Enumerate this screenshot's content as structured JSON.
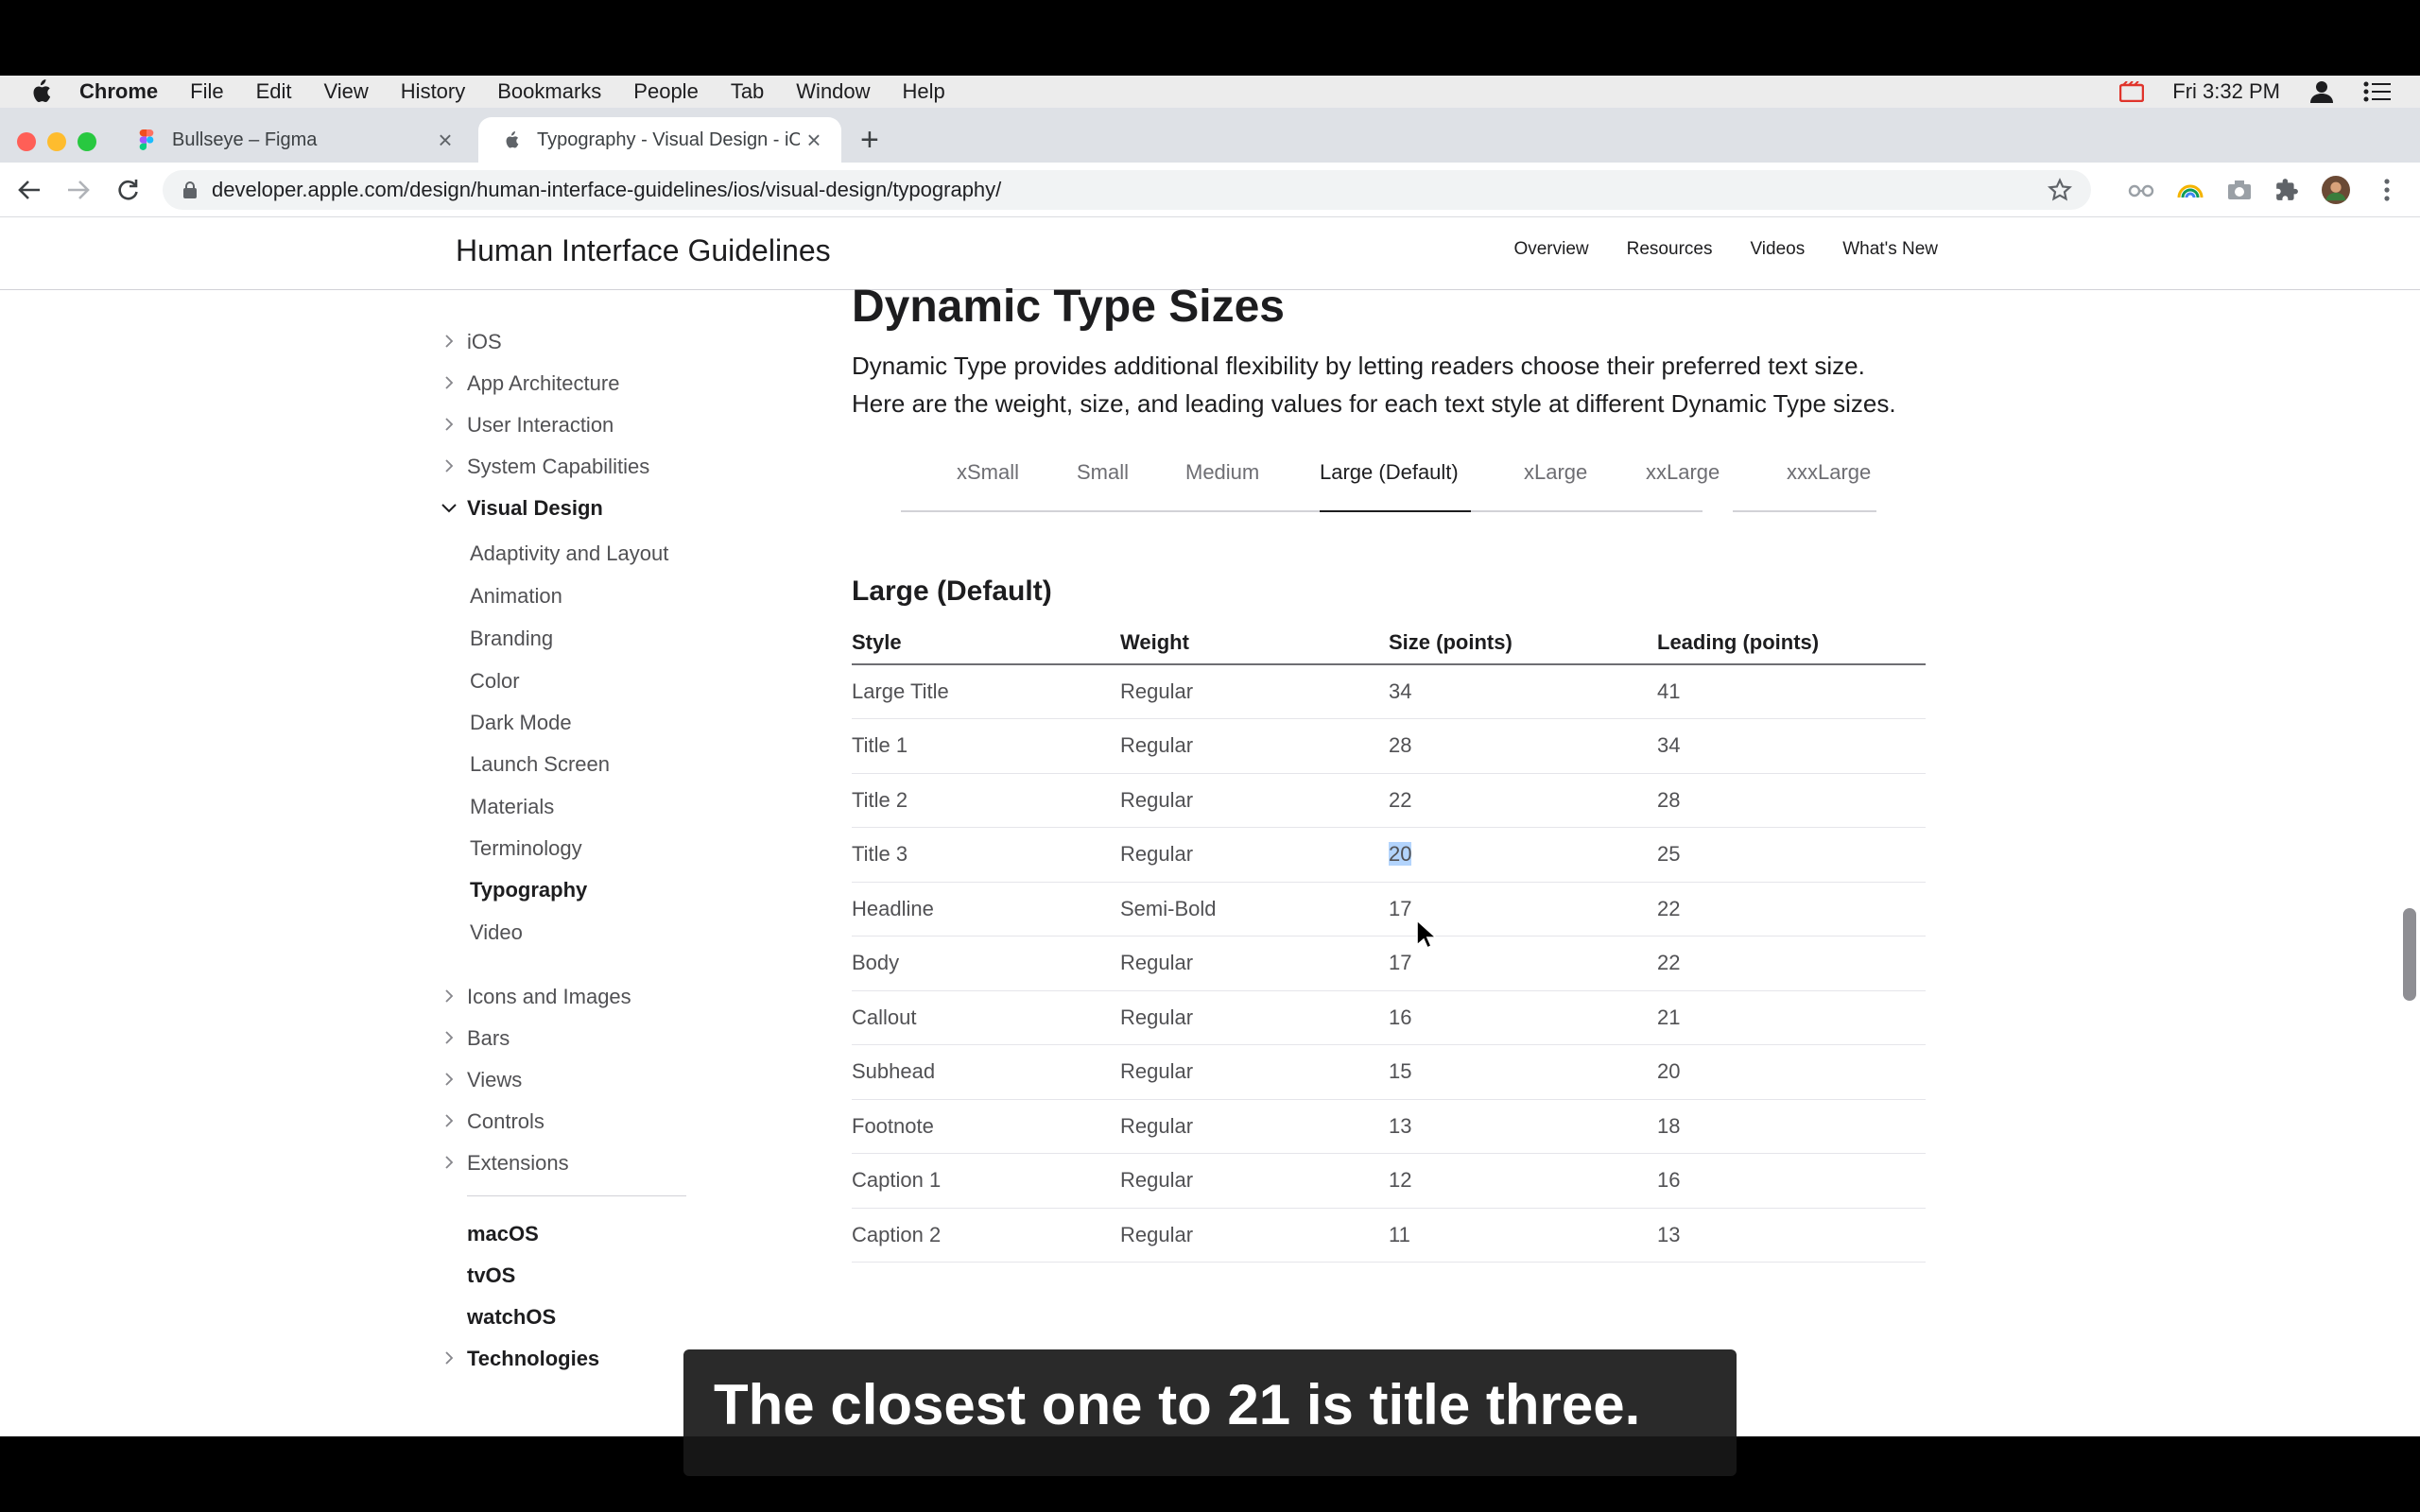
{
  "menubar": {
    "app": "Chrome",
    "items": [
      "File",
      "Edit",
      "View",
      "History",
      "Bookmarks",
      "People",
      "Tab",
      "Window",
      "Help"
    ],
    "clock": "Fri 3:32 PM"
  },
  "tabs": [
    {
      "title": "Bullseye – Figma",
      "icon": "figma-icon"
    },
    {
      "title": "Typography - Visual Design - iO",
      "icon": "apple-icon"
    }
  ],
  "address": "developer.apple.com/design/human-interface-guidelines/ios/visual-design/typography/",
  "header": {
    "title": "Human Interface Guidelines",
    "nav": [
      "Overview",
      "Resources",
      "Videos",
      "What's New"
    ]
  },
  "sidebar": {
    "collapsed_top": [
      "iOS",
      "App Architecture",
      "User Interaction",
      "System Capabilities"
    ],
    "expanded": "Visual Design",
    "sub": [
      "Adaptivity and Layout",
      "Animation",
      "Branding",
      "Color",
      "Dark Mode",
      "Launch Screen",
      "Materials",
      "Terminology",
      "Typography",
      "Video"
    ],
    "selected": "Typography",
    "collapsed_bottom": [
      "Icons and Images",
      "Bars",
      "Views",
      "Controls",
      "Extensions"
    ],
    "platforms": [
      "macOS",
      "tvOS",
      "watchOS"
    ],
    "technologies": "Technologies"
  },
  "content": {
    "heading": "Dynamic Type Sizes",
    "intro": "Dynamic Type provides additional flexibility by letting readers choose their preferred text size. Here are the weight, size, and leading values for each text style at different Dynamic Type sizes.",
    "size_tabs": [
      "xSmall",
      "Small",
      "Medium",
      "Large (Default)",
      "xLarge",
      "xxLarge",
      "xxxLarge"
    ],
    "selected_size": "Large (Default)",
    "table_title": "Large (Default)",
    "columns": [
      "Style",
      "Weight",
      "Size (points)",
      "Leading (points)"
    ],
    "rows": [
      [
        "Large Title",
        "Regular",
        "34",
        "41"
      ],
      [
        "Title 1",
        "Regular",
        "28",
        "34"
      ],
      [
        "Title 2",
        "Regular",
        "22",
        "28"
      ],
      [
        "Title 3",
        "Regular",
        "20",
        "25"
      ],
      [
        "Headline",
        "Semi-Bold",
        "17",
        "22"
      ],
      [
        "Body",
        "Regular",
        "17",
        "22"
      ],
      [
        "Callout",
        "Regular",
        "16",
        "21"
      ],
      [
        "Subhead",
        "Regular",
        "15",
        "20"
      ],
      [
        "Footnote",
        "Regular",
        "13",
        "18"
      ],
      [
        "Caption 1",
        "Regular",
        "12",
        "16"
      ],
      [
        "Caption 2",
        "Regular",
        "11",
        "13"
      ]
    ],
    "highlighted_cell": "20"
  },
  "caption": "The closest one to 21 is title three.",
  "colors": {
    "accent": "#1d1d1f",
    "highlight": "#b3d4fc",
    "tabstrip": "#dee1e6"
  }
}
